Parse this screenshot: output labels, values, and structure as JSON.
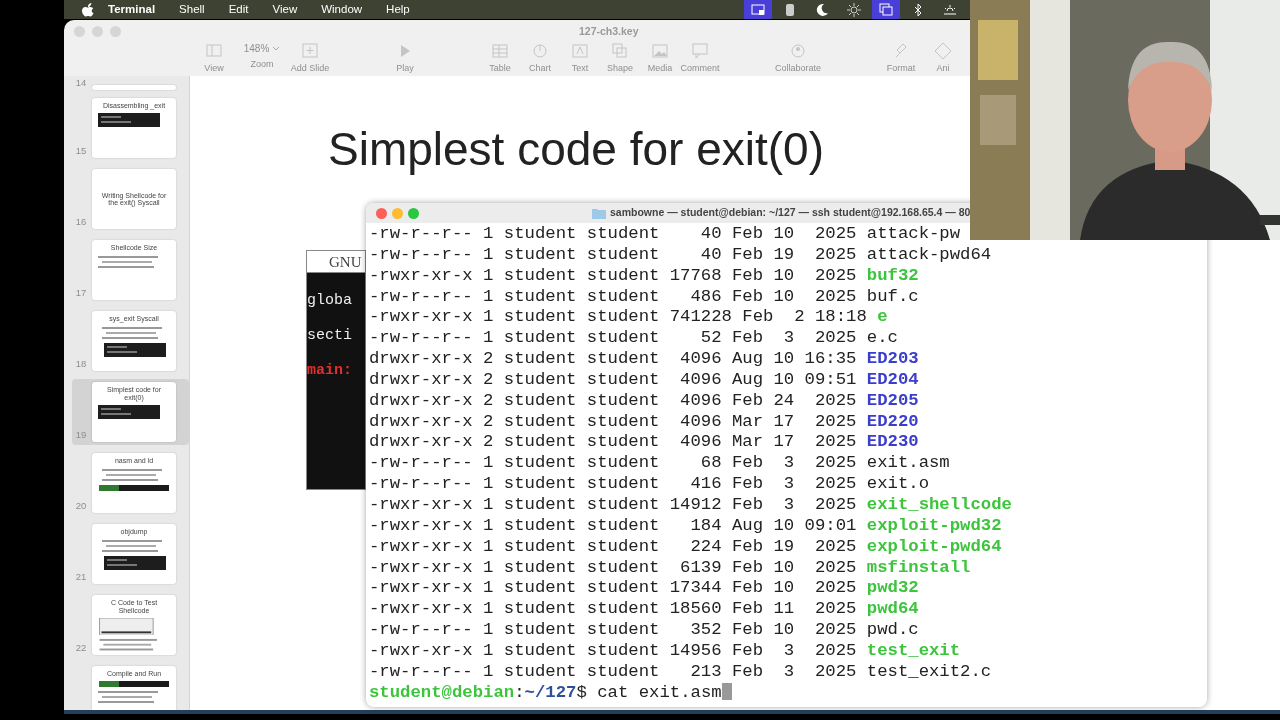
{
  "menu_bar": {
    "app": "Terminal",
    "items": [
      "Shell",
      "Edit",
      "View",
      "Window",
      "Help"
    ],
    "status_icons": [
      {
        "kind": "screen",
        "highlighted": true
      },
      {
        "kind": "app",
        "highlighted": false
      },
      {
        "kind": "moon",
        "highlighted": false
      },
      {
        "kind": "sun",
        "highlighted": false
      },
      {
        "kind": "windows",
        "highlighted": true
      },
      {
        "kind": "bluetooth",
        "highlighted": false
      },
      {
        "kind": "sunrise",
        "highlighted": false
      }
    ]
  },
  "keynote": {
    "title": "127-ch3.key",
    "toolbar": [
      {
        "kind": "view",
        "label": "View"
      },
      {
        "kind": "zoom",
        "value": "148%",
        "label": "Zoom"
      },
      {
        "kind": "add",
        "label": "Add Slide"
      },
      {
        "kind": "play",
        "label": "Play"
      },
      {
        "kind": "table",
        "label": "Table"
      },
      {
        "kind": "chart",
        "label": "Chart"
      },
      {
        "kind": "text",
        "label": "Text"
      },
      {
        "kind": "shape",
        "label": "Shape"
      },
      {
        "kind": "media",
        "label": "Media"
      },
      {
        "kind": "comment",
        "label": "Comment"
      },
      {
        "kind": "collaborate",
        "label": "Collaborate"
      },
      {
        "kind": "format",
        "label": "Format"
      },
      {
        "kind": "animate",
        "label": "Ani"
      }
    ],
    "slides": [
      {
        "number": "14",
        "kind": "cut",
        "selected": false
      },
      {
        "number": "15",
        "title": "Disassembling _exit",
        "kind": "code",
        "selected": false
      },
      {
        "number": "16",
        "title": "Writing Shellcode for the exit() Syscall",
        "kind": "title",
        "selected": false
      },
      {
        "number": "17",
        "title": "Shellcode Size",
        "kind": "bullets",
        "selected": false
      },
      {
        "number": "18",
        "title": "sys_exit Syscall",
        "kind": "bullets-image",
        "selected": false
      },
      {
        "number": "19",
        "title": "Simplest code for exit(0)",
        "kind": "code",
        "selected": true
      },
      {
        "number": "20",
        "title": "nasm and ld",
        "kind": "bullets-bar",
        "selected": false
      },
      {
        "number": "21",
        "title": "objdump",
        "kind": "bullets-image",
        "selected": false
      },
      {
        "number": "22",
        "title": "C Code to Test Shellcode",
        "kind": "image-bullets",
        "selected": false
      },
      {
        "title": "Compile and Run",
        "kind": "bar-bullets",
        "selected": false
      }
    ],
    "slide": {
      "title": "Simplest code for exit(0)",
      "code_header": "GNU",
      "code_lines": [
        {
          "text": "globa",
          "kind": "plain"
        },
        {
          "text": "secti",
          "kind": "plain"
        },
        {
          "text": "main:",
          "kind": "label"
        }
      ]
    }
  },
  "terminal": {
    "title": "sambowne — student@debian: ~/127 — ssh student@192.168.65.4 — 80",
    "lines": [
      {
        "text": "-rw-r--r-- 1 student student    40 Feb 10  2025 ",
        "name": "attack-pw",
        "kind": "file"
      },
      {
        "text": "-rw-r--r-- 1 student student    40 Feb 19  2025 ",
        "name": "attack-pwd64",
        "kind": "file"
      },
      {
        "text": "-rwxr-xr-x 1 student student 17768 Feb 10  2025 ",
        "name": "buf32",
        "kind": "exec"
      },
      {
        "text": "-rw-r--r-- 1 student student   486 Feb 10  2025 ",
        "name": "buf.c",
        "kind": "file"
      },
      {
        "text": "-rwxr-xr-x 1 student student 741228 Feb  2 18:18 ",
        "name": "e",
        "kind": "exec"
      },
      {
        "text": "-rw-r--r-- 1 student student    52 Feb  3  2025 ",
        "name": "e.c",
        "kind": "file"
      },
      {
        "text": "drwxr-xr-x 2 student student  4096 Aug 10 16:35 ",
        "name": "ED203",
        "kind": "dir"
      },
      {
        "text": "drwxr-xr-x 2 student student  4096 Aug 10 09:51 ",
        "name": "ED204",
        "kind": "dir"
      },
      {
        "text": "drwxr-xr-x 2 student student  4096 Feb 24  2025 ",
        "name": "ED205",
        "kind": "dir"
      },
      {
        "text": "drwxr-xr-x 2 student student  4096 Mar 17  2025 ",
        "name": "ED220",
        "kind": "dir"
      },
      {
        "text": "drwxr-xr-x 2 student student  4096 Mar 17  2025 ",
        "name": "ED230",
        "kind": "dir"
      },
      {
        "text": "-rw-r--r-- 1 student student    68 Feb  3  2025 ",
        "name": "exit.asm",
        "kind": "file"
      },
      {
        "text": "-rw-r--r-- 1 student student   416 Feb  3  2025 ",
        "name": "exit.o",
        "kind": "file"
      },
      {
        "text": "-rwxr-xr-x 1 student student 14912 Feb  3  2025 ",
        "name": "exit_shellcode",
        "kind": "exec"
      },
      {
        "text": "-rwxr-xr-x 1 student student   184 Aug 10 09:01 ",
        "name": "exploit-pwd32",
        "kind": "exec"
      },
      {
        "text": "-rwxr-xr-x 1 student student   224 Feb 19  2025 ",
        "name": "exploit-pwd64",
        "kind": "exec"
      },
      {
        "text": "-rwxr-xr-x 1 student student  6139 Feb 10  2025 ",
        "name": "msfinstall",
        "kind": "exec"
      },
      {
        "text": "-rwxr-xr-x 1 student student 17344 Feb 10  2025 ",
        "name": "pwd32",
        "kind": "exec"
      },
      {
        "text": "-rwxr-xr-x 1 student student 18560 Feb 11  2025 ",
        "name": "pwd64",
        "kind": "exec"
      },
      {
        "text": "-rw-r--r-- 1 student student   352 Feb 10  2025 ",
        "name": "pwd.c",
        "kind": "file"
      },
      {
        "text": "-rwxr-xr-x 1 student student 14956 Feb  3  2025 ",
        "name": "test_exit",
        "kind": "exec"
      },
      {
        "text": "-rw-r--r-- 1 student student   213 Feb  3  2025 ",
        "name": "test_exit2.c",
        "kind": "file"
      }
    ],
    "prompt": {
      "user_host": "student@debian",
      "separator": ":",
      "path": "~/127",
      "symbol": "$",
      "command": "cat exit.asm"
    }
  }
}
